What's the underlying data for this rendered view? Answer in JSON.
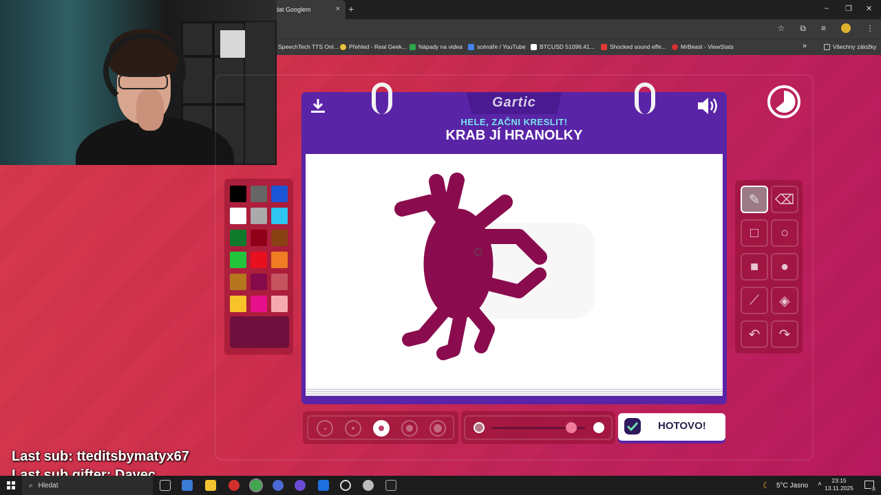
{
  "browser": {
    "tab_title": "dat Googlem",
    "tab_close": "×",
    "new_tab": "+",
    "window_controls": [
      "–",
      "❐",
      "✕"
    ],
    "bookmarks": [
      {
        "label": "SpeechTech TTS Onl...",
        "color": "#3c3c3c"
      },
      {
        "label": "Přehled - Real Geek...",
        "color": "#e8c23a"
      },
      {
        "label": "Nápady na videa",
        "color": "#2fa54a"
      },
      {
        "label": "scénáře / YouTube",
        "color": "#4285f4"
      },
      {
        "label": "BTCUSD 51096.41...",
        "color": "#111111"
      },
      {
        "label": "Shocked sound effe...",
        "color": "#e53935"
      },
      {
        "label": "MrBeast - ViewStats",
        "color": "#d32f2f"
      }
    ],
    "bookmarks_more": "»",
    "all_bookmarks": "Všechny záložky"
  },
  "game": {
    "logo": "Gartic",
    "hint": "HELE, ZAČNI KRESLIT!",
    "word": "KRAB JÍ HRANOLKY",
    "done_label": "HOTOVO!",
    "palette": [
      "#000000",
      "#666666",
      "#1a56d6",
      "#ffffff",
      "#aaaaaa",
      "#2ec5f0",
      "#0f7a2b",
      "#8f0018",
      "#8a4114",
      "#22c43c",
      "#e8101f",
      "#f07c23",
      "#b5761f",
      "#850a4a",
      "#c65460",
      "#f7c22a",
      "#e8108a",
      "#f6aab0"
    ],
    "current_color": "#6f0f3e",
    "tools": [
      "pencil-icon",
      "eraser-icon",
      "rectangle-outline-icon",
      "ellipse-outline-icon",
      "rectangle-filled-icon",
      "ellipse-filled-icon",
      "line-icon",
      "fill-bucket-icon",
      "undo-icon",
      "redo-icon"
    ],
    "active_tool": "pencil-icon",
    "brush_sizes": 5,
    "active_size_index": 2,
    "opacity_fraction": 0.85
  },
  "overlay": {
    "last_sub": "Last sub: tteditsbymatyx67",
    "last_gifter": "Last sub gifter: Davec"
  },
  "taskbar": {
    "search_placeholder": "Hledat",
    "weather": "5°C  Jasno",
    "time": "23:15",
    "date": "13.11.2025",
    "notification_count": "3"
  }
}
